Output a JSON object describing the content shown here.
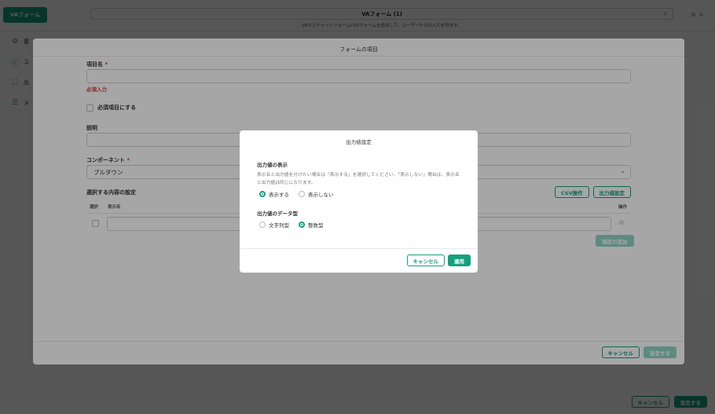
{
  "base": {
    "app_chip": "VAフォーム",
    "form_title": "VAフォーム (1)",
    "form_description": "VAからチャットフォームCSVフォームを追加して、ユーザーからの入力を得ます。",
    "sidebar": [
      {
        "label": "基",
        "icon": "gear-icon"
      },
      {
        "label": "ユ",
        "icon": "info-icon"
      },
      {
        "label": "出",
        "icon": "frame-icon"
      },
      {
        "label": "メ",
        "icon": "list-icon"
      }
    ],
    "footer": {
      "cancel": "キャンセル",
      "confirm": "設定する"
    }
  },
  "form_dialog": {
    "title": "フォームの項目",
    "item_name_label": "項目名",
    "required_mark": "*",
    "required_error": "必須入力",
    "required_checkbox_label": "必須項目にする",
    "description_label": "説明",
    "component_label": "コンポーネント",
    "component_value": "プルダウン",
    "options_label": "選択する内容の設定",
    "csv_button": "CSV操作",
    "output_button": "出力値設定",
    "table_headers": {
      "select": "選択",
      "display_name": "表示名",
      "actions": "操作"
    },
    "add_item_button": "項目の追加",
    "cancel": "キャンセル",
    "confirm": "設定する"
  },
  "output_dialog": {
    "title": "出力値設定",
    "display_section_label": "出力値の表示",
    "display_description": "表示名と出力値を分けたい場合は「表示する」を選択してください。「表示しない」場合は、表示名と出力値は同じになります。",
    "display_options": [
      {
        "label": "表示する",
        "selected": true
      },
      {
        "label": "表示しない",
        "selected": false
      }
    ],
    "type_section_label": "出力値のデータ型",
    "type_options": [
      {
        "label": "文字列型",
        "selected": false
      },
      {
        "label": "整数型",
        "selected": true
      }
    ],
    "cancel": "キャンセル",
    "apply": "適用"
  },
  "colors": {
    "accent": "#14a07d",
    "error": "#dd3333"
  }
}
